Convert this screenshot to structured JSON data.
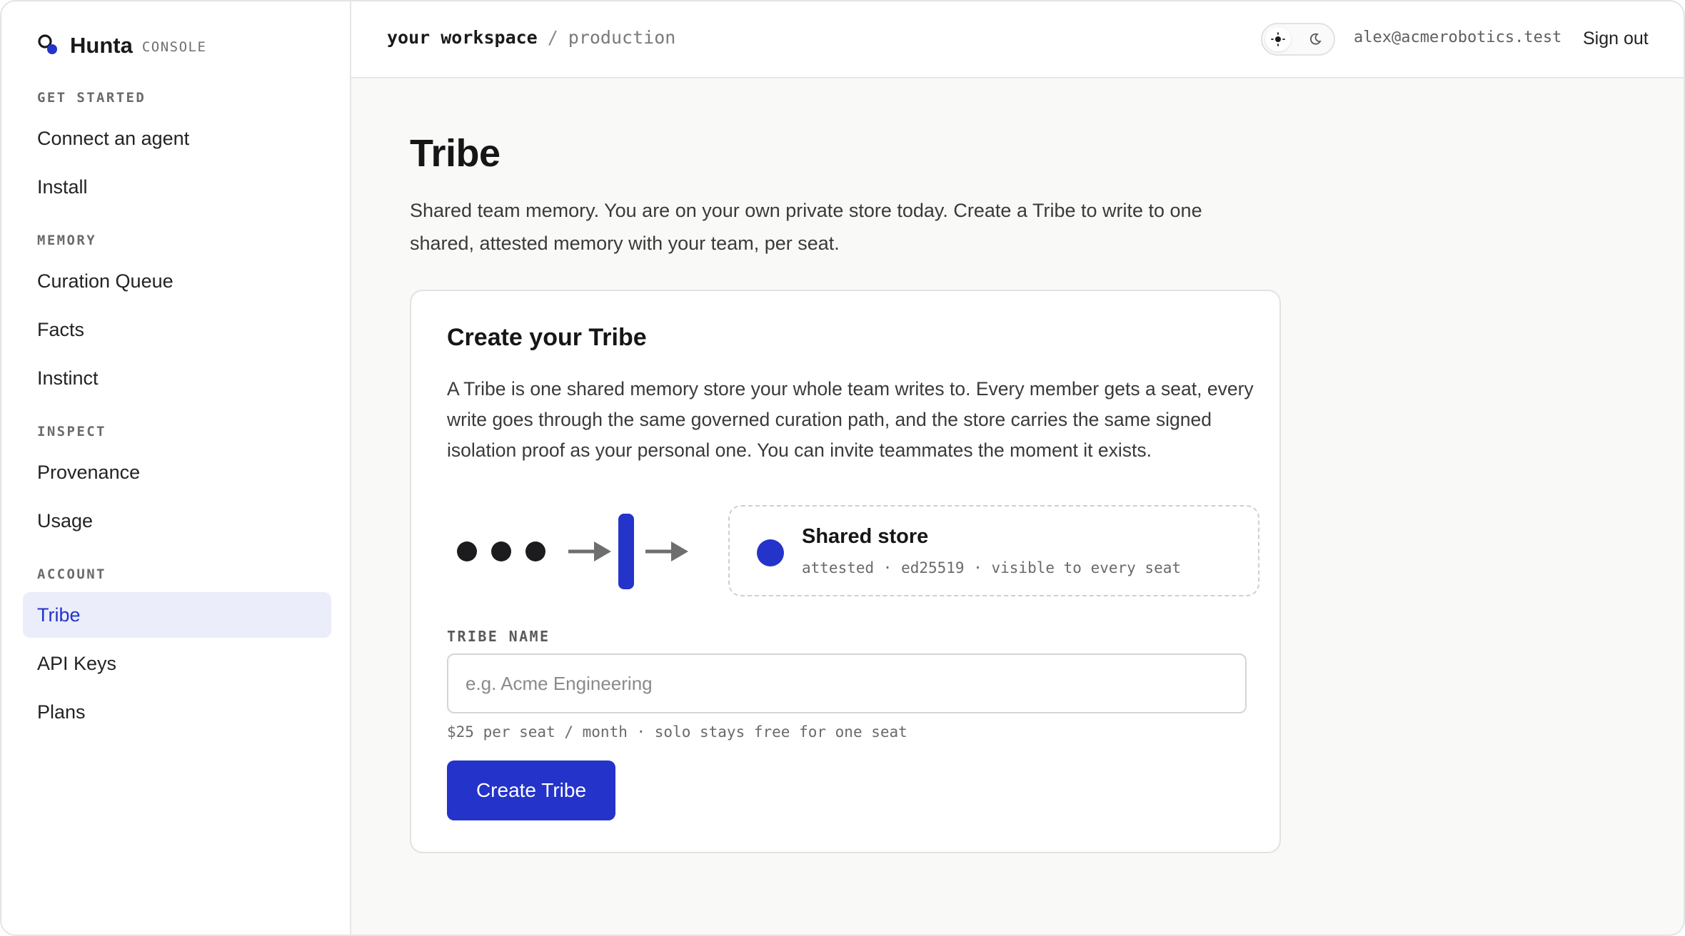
{
  "brand": {
    "name": "Hunta",
    "tag": "CONSOLE"
  },
  "sidebar": {
    "sections": [
      {
        "title": "GET STARTED",
        "items": [
          {
            "label": "Connect an agent"
          },
          {
            "label": "Install"
          }
        ]
      },
      {
        "title": "MEMORY",
        "items": [
          {
            "label": "Curation Queue"
          },
          {
            "label": "Facts"
          },
          {
            "label": "Instinct"
          }
        ]
      },
      {
        "title": "INSPECT",
        "items": [
          {
            "label": "Provenance"
          },
          {
            "label": "Usage"
          }
        ]
      },
      {
        "title": "ACCOUNT",
        "items": [
          {
            "label": "Tribe",
            "active": true
          },
          {
            "label": "API Keys"
          },
          {
            "label": "Plans"
          }
        ]
      }
    ]
  },
  "header": {
    "workspace": "your workspace",
    "separator": "/",
    "environment": "production",
    "user_email": "alex@acmerobotics.test",
    "sign_out": "Sign out",
    "theme": {
      "light_icon": "sun-icon",
      "dark_icon": "moon-icon",
      "selected": "light"
    }
  },
  "main": {
    "title": "Tribe",
    "description": "Shared team memory. You are on your own private store today. Create a Tribe to write to one shared, attested memory with your team, per seat.",
    "card": {
      "title": "Create your Tribe",
      "description": "A Tribe is one shared memory store your whole team writes to. Every member gets a seat, every write goes through the same governed curation path, and the store carries the same signed isolation proof as your personal one. You can invite teammates the moment it exists.",
      "diagram": {
        "store_title": "Shared store",
        "store_meta": "attested · ed25519 · visible to every seat"
      },
      "field_label": "TRIBE NAME",
      "field_placeholder": "e.g. Acme Engineering",
      "field_value": "",
      "hint": "$25 per seat / month · solo stays free for one seat",
      "button_label": "Create Tribe"
    }
  },
  "colors": {
    "accent": "#2433c9",
    "active_bg": "#ebedfa",
    "dots": "#1c1c1e",
    "arrows": "#6e6e6e"
  }
}
